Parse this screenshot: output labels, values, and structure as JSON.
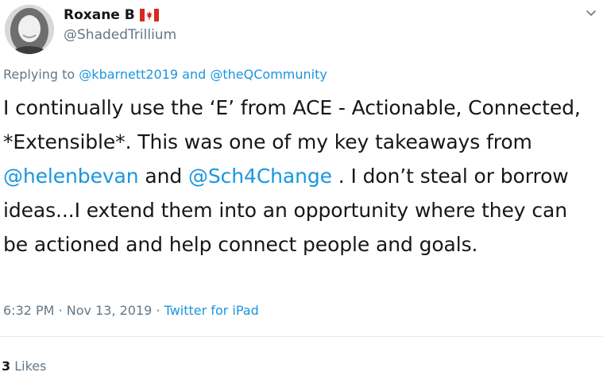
{
  "tweet": {
    "author_name": "Roxane B",
    "author_flag": "canada-flag-icon",
    "author_handle": "@ShadedTrillium",
    "replying_prefix": "Replying to",
    "reply_to_1": "@kbarnett2019",
    "reply_and": "and",
    "reply_to_2": "@theQCommunity",
    "body_1": "I continually use the ‘E’ from ACE - Actionable, Connected, *Extensible*. This was one of my key takeaways from ",
    "mention_1": "@helenbevan",
    "body_2": " and ",
    "mention_2": "@Sch4Change",
    "body_3": " . I don’t steal or borrow ideas...I extend them into an opportunity where they can be actioned and help connect people and goals.",
    "time": "6:32 PM",
    "date": "Nov 13, 2019",
    "separator": "·",
    "source": "Twitter for iPad",
    "likes_count": "3",
    "likes_label": "Likes"
  },
  "colors": {
    "link": "#1b95e0",
    "muted": "#657786",
    "text": "#14171a",
    "flag_red": "#d52b1e"
  }
}
